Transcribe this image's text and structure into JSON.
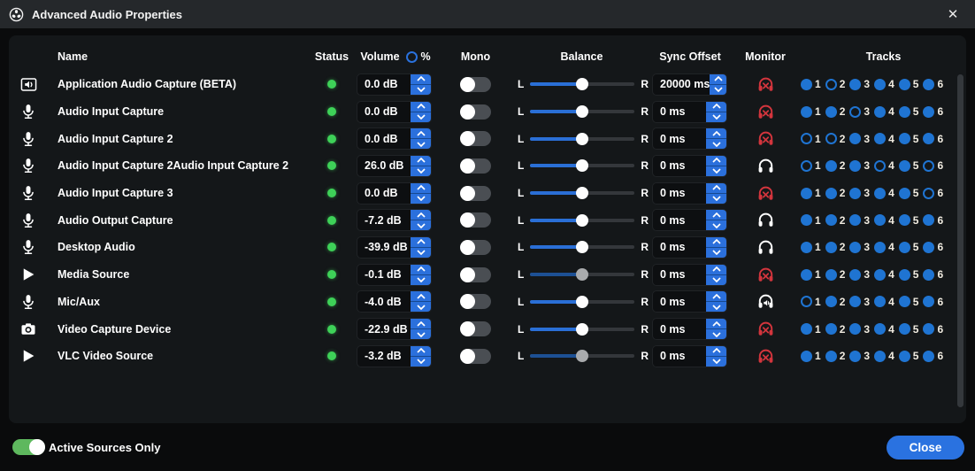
{
  "window": {
    "title": "Advanced Audio Properties",
    "app_icon": "obs-logo-icon",
    "close_glyph": "✕"
  },
  "colors": {
    "accent_blue": "#2a71dc",
    "status_green": "#3ed158",
    "monitor_muted_red": "#d3353d",
    "titlebar": "#25282b",
    "panel": "#141719"
  },
  "labels": {
    "balance_left": "L",
    "balance_right": "R",
    "track_numbers": [
      "1",
      "2",
      "3",
      "4",
      "5",
      "6"
    ]
  },
  "header": {
    "name": "Name",
    "status": "Status",
    "volume": "Volume",
    "volume_percent": "%",
    "mono": "Mono",
    "balance": "Balance",
    "sync_offset": "Sync Offset",
    "monitor": "Monitor",
    "tracks": "Tracks"
  },
  "rows": [
    {
      "name": "Application Audio Capture (BETA)",
      "icon": "application-audio-icon",
      "status": "active",
      "volume": "0.0 dB",
      "mono": false,
      "balance": 50,
      "balance_disabled": false,
      "sync_offset": "20000 ms",
      "monitor_state": "monitor-muted",
      "tracks": [
        1,
        0,
        1,
        1,
        1,
        1
      ]
    },
    {
      "name": "Audio Input Capture",
      "icon": "microphone-icon",
      "status": "active",
      "volume": "0.0 dB",
      "mono": false,
      "balance": 50,
      "balance_disabled": false,
      "sync_offset": "0 ms",
      "monitor_state": "monitor-muted",
      "tracks": [
        1,
        1,
        0,
        1,
        1,
        1
      ]
    },
    {
      "name": "Audio Input Capture 2",
      "icon": "microphone-icon",
      "status": "active",
      "volume": "0.0 dB",
      "mono": false,
      "balance": 50,
      "balance_disabled": false,
      "sync_offset": "0 ms",
      "monitor_state": "monitor-muted",
      "tracks": [
        0,
        0,
        1,
        1,
        1,
        1
      ]
    },
    {
      "name": "Audio Input Capture 2Audio Input Capture 2",
      "icon": "microphone-icon",
      "status": "active",
      "volume": "26.0 dB",
      "mono": false,
      "balance": 50,
      "balance_disabled": false,
      "sync_offset": "0 ms",
      "monitor_state": "monitor-only",
      "tracks": [
        0,
        1,
        1,
        0,
        1,
        0
      ]
    },
    {
      "name": "Audio Input Capture 3",
      "icon": "microphone-icon",
      "status": "active",
      "volume": "0.0 dB",
      "mono": false,
      "balance": 50,
      "balance_disabled": false,
      "sync_offset": "0 ms",
      "monitor_state": "monitor-muted",
      "tracks": [
        1,
        1,
        1,
        1,
        1,
        0
      ]
    },
    {
      "name": "Audio Output Capture",
      "icon": "microphone-icon",
      "status": "active",
      "volume": "-7.2 dB",
      "mono": false,
      "balance": 50,
      "balance_disabled": false,
      "sync_offset": "0 ms",
      "monitor_state": "monitor-only",
      "tracks": [
        1,
        1,
        1,
        1,
        1,
        1
      ]
    },
    {
      "name": "Desktop Audio",
      "icon": "microphone-icon",
      "status": "active",
      "volume": "-39.9 dB",
      "mono": false,
      "balance": 50,
      "balance_disabled": false,
      "sync_offset": "0 ms",
      "monitor_state": "monitor-only",
      "tracks": [
        1,
        1,
        1,
        1,
        1,
        1
      ]
    },
    {
      "name": "Media Source",
      "icon": "play-icon",
      "status": "active",
      "volume": "-0.1 dB",
      "mono": false,
      "balance": 50,
      "balance_disabled": true,
      "sync_offset": "0 ms",
      "monitor_state": "monitor-muted",
      "tracks": [
        1,
        1,
        1,
        1,
        1,
        1
      ]
    },
    {
      "name": "Mic/Aux",
      "icon": "microphone-icon",
      "status": "active",
      "volume": "-4.0 dB",
      "mono": false,
      "balance": 50,
      "balance_disabled": false,
      "sync_offset": "0 ms",
      "monitor_state": "monitor-and-output",
      "tracks": [
        0,
        1,
        1,
        1,
        1,
        1
      ]
    },
    {
      "name": "Video Capture Device",
      "icon": "camera-icon",
      "status": "active",
      "volume": "-22.9 dB",
      "mono": false,
      "balance": 50,
      "balance_disabled": false,
      "sync_offset": "0 ms",
      "monitor_state": "monitor-muted",
      "tracks": [
        1,
        1,
        1,
        1,
        1,
        1
      ]
    },
    {
      "name": "VLC Video Source",
      "icon": "play-icon",
      "status": "active",
      "volume": "-3.2 dB",
      "mono": false,
      "balance": 50,
      "balance_disabled": true,
      "sync_offset": "0 ms",
      "monitor_state": "monitor-muted",
      "tracks": [
        1,
        1,
        1,
        1,
        1,
        1
      ]
    }
  ],
  "footer": {
    "active_sources_label": "Active Sources Only",
    "active_sources_on": true,
    "close_label": "Close"
  }
}
